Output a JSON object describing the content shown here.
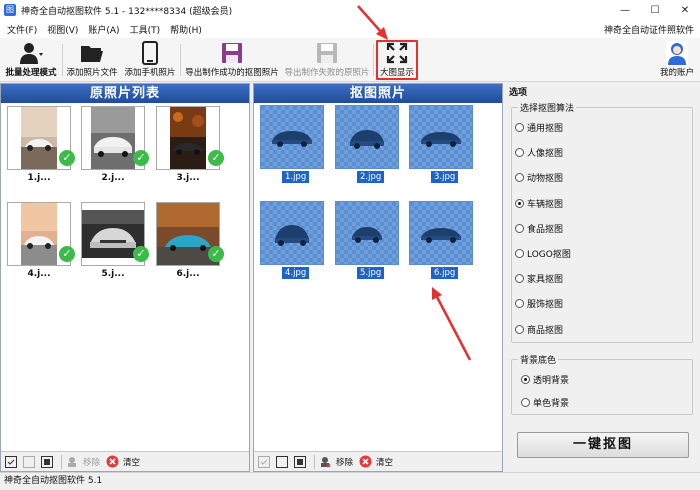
{
  "window": {
    "title": "神奇全自动抠图软件 5.1 - 132****8334 (超级会员)",
    "controls": [
      "—",
      "☐",
      "✕"
    ]
  },
  "menu": {
    "items": [
      "文件(F)",
      "视图(V)",
      "账户(A)",
      "工具(T)",
      "帮助(H)"
    ],
    "right_link": "神奇全自动证件照软件"
  },
  "toolbar": {
    "batch_mode": "批量处理模式",
    "add_photo": "添加照片文件",
    "add_phone": "添加手机照片",
    "export_success": "导出制作成功的抠图照片",
    "export_failed": "导出制作失败的原照片",
    "big_view": "大图显示",
    "my_account": "我的账户"
  },
  "left_panel": {
    "title": "原照片列表",
    "items": [
      {
        "caption": "1.j..."
      },
      {
        "caption": "2.j..."
      },
      {
        "caption": "3.j..."
      },
      {
        "caption": "4.j..."
      },
      {
        "caption": "5.j..."
      },
      {
        "caption": "6.j..."
      }
    ],
    "footer": {
      "remove": "移除",
      "clear": "清空"
    }
  },
  "middle_panel": {
    "title": "抠图照片",
    "items": [
      {
        "caption": "1.jpg"
      },
      {
        "caption": "2.jpg"
      },
      {
        "caption": "3.jpg"
      },
      {
        "caption": "4.jpg"
      },
      {
        "caption": "5.jpg"
      },
      {
        "caption": "6.jpg"
      }
    ],
    "footer": {
      "remove": "移除",
      "clear": "清空"
    }
  },
  "options": {
    "title": "选项",
    "algorithm_group": "选择抠图算法",
    "algorithms": [
      "通用抠图",
      "人像抠图",
      "动物抠图",
      "车辆抠图",
      "食品抠图",
      "LOGO抠图",
      "家具抠图",
      "服饰抠图",
      "商品抠图"
    ],
    "selected_algorithm": "车辆抠图",
    "background_group": "背景底色",
    "backgrounds": [
      "透明背景",
      "单色背景"
    ],
    "selected_background": "透明背景",
    "run_button": "一键抠图"
  },
  "status_bar": {
    "text": "神奇全自动抠图软件 5.1"
  },
  "colors": {
    "panel_header": "#2a56a8",
    "check_green": "#3dbb4a",
    "highlight_red": "#e53030",
    "selection_blue": "#1e64c8"
  }
}
